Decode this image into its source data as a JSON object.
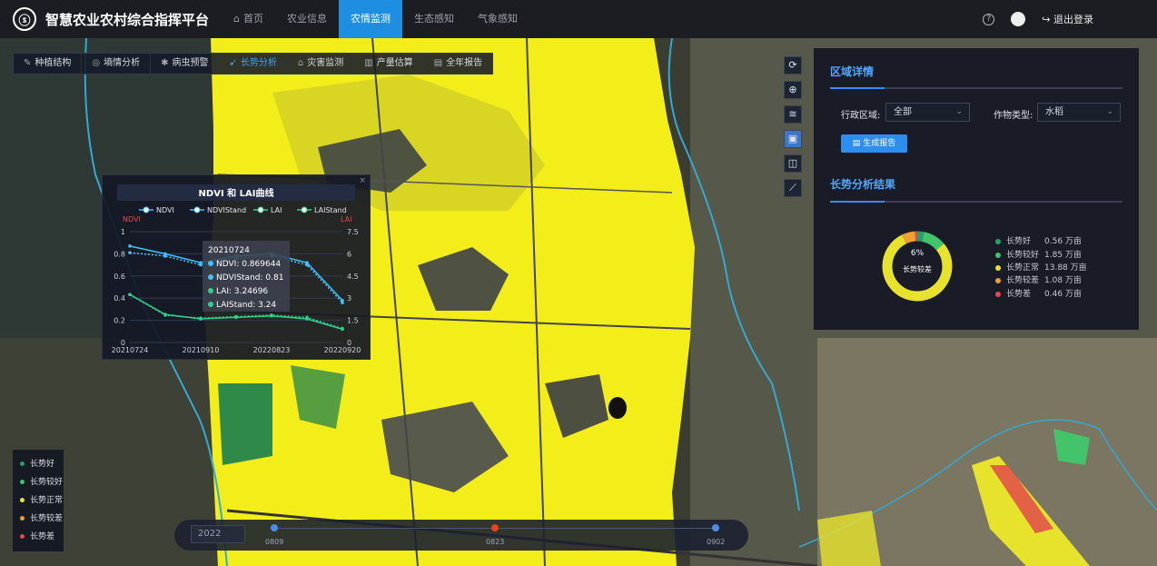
{
  "header": {
    "app_title": "智慧农业农村综合指挥平台",
    "nav": [
      {
        "label": "首页",
        "active": false
      },
      {
        "label": "农业信息",
        "active": false
      },
      {
        "label": "农情监测",
        "active": true
      },
      {
        "label": "生态感知",
        "active": false
      },
      {
        "label": "气象感知",
        "active": false
      }
    ],
    "help_glyph": "?",
    "logout_label": "退出登录"
  },
  "subtabs": [
    {
      "icon": "✎",
      "label": "种植结构",
      "active": false
    },
    {
      "icon": "◎",
      "label": "墒情分析",
      "active": false
    },
    {
      "icon": "✱",
      "label": "病虫预警",
      "active": false
    },
    {
      "icon": "➹",
      "label": "长势分析",
      "active": true
    },
    {
      "icon": "⌂",
      "label": "灾害监测",
      "active": false
    },
    {
      "icon": "▥",
      "label": "产量估算",
      "active": false
    },
    {
      "icon": "▤",
      "label": "全年报告",
      "active": false
    }
  ],
  "tools": [
    "refresh-icon",
    "locate-icon",
    "layers-icon",
    "image-icon",
    "book-icon",
    "ruler-icon"
  ],
  "region_panel": {
    "title": "区域详情",
    "region_label": "行政区域:",
    "region_value": "全部",
    "crop_label": "作物类型:",
    "crop_value": "水稻",
    "generate_label": "生成报告"
  },
  "growth_panel": {
    "title": "长势分析结果",
    "donut_percent": "6%",
    "donut_label": "长势较差",
    "items": [
      {
        "name": "长势好",
        "value": "0.56 万亩",
        "color": "#2a9d6e",
        "share": 0.031
      },
      {
        "name": "长势较好",
        "value": "1.85 万亩",
        "color": "#43c46b",
        "share": 0.107
      },
      {
        "name": "长势正常",
        "value": "13.88 万亩",
        "color": "#e7e32c",
        "share": 0.788
      },
      {
        "name": "长势较差",
        "value": "1.08 万亩",
        "color": "#f0a033",
        "share": 0.062
      },
      {
        "name": "长势差",
        "value": "0.46 万亩",
        "color": "#e04b4b",
        "share": 0.012
      }
    ]
  },
  "chart_popup": {
    "close_glyph": "×",
    "tooltip": {
      "date": "20210724",
      "lines": [
        "NDVI: 0.869644",
        "NDVIStand: 0.81",
        "LAI: 3.24696",
        "LAIStand: 3.24"
      ]
    }
  },
  "chart_data": {
    "type": "line",
    "title": "NDVI 和 LAI曲线",
    "legend": [
      "NDVI",
      "NDVIStand",
      "LAI",
      "LAIStand"
    ],
    "y_left_label": "NDVI",
    "y_right_label": "LAI",
    "y_left_ticks": [
      "0",
      "0.2",
      "0.4",
      "0.6",
      "0.8",
      "1"
    ],
    "y_right_ticks": [
      "0",
      "1.5",
      "3",
      "4.5",
      "6",
      "7.5"
    ],
    "ylim_left": [
      0,
      1
    ],
    "ylim_right": [
      0,
      7.5
    ],
    "x_ticks": [
      "20210724",
      "20210910",
      "20220823",
      "20220920"
    ],
    "x_count": 7,
    "series": [
      {
        "name": "NDVI",
        "axis": "left",
        "color": "#3fc2ff",
        "dashed": false,
        "x": [
          0,
          1,
          2,
          3,
          4,
          5,
          6
        ],
        "values": [
          0.87,
          0.8,
          0.72,
          0.78,
          0.8,
          0.72,
          0.38
        ]
      },
      {
        "name": "NDVIStand",
        "axis": "left",
        "color": "#3fc2ff",
        "dashed": true,
        "x": [
          0,
          1,
          2,
          3,
          4,
          5,
          6
        ],
        "values": [
          0.81,
          0.78,
          0.7,
          0.76,
          0.78,
          0.7,
          0.36
        ]
      },
      {
        "name": "LAI",
        "axis": "right",
        "color": "#2fd08a",
        "dashed": false,
        "x": [
          0,
          1,
          2,
          3,
          4,
          5,
          6
        ],
        "values": [
          3.25,
          1.9,
          1.6,
          1.7,
          1.8,
          1.6,
          0.9
        ]
      },
      {
        "name": "LAIStand",
        "axis": "right",
        "color": "#2fd08a",
        "dashed": true,
        "x": [
          0,
          1,
          2,
          3,
          4,
          5,
          6
        ],
        "values": [
          3.24,
          1.85,
          1.65,
          1.75,
          1.85,
          1.7,
          0.95
        ]
      }
    ],
    "grid": "horizontal",
    "legend_position": "top"
  },
  "map_legend": [
    {
      "name": "长势好",
      "color": "#2a9d6e"
    },
    {
      "name": "长势较好",
      "color": "#43c46b"
    },
    {
      "name": "长势正常",
      "color": "#e7e32c"
    },
    {
      "name": "长势较差",
      "color": "#f0a033"
    },
    {
      "name": "长势差",
      "color": "#e04b4b"
    }
  ],
  "timeline": {
    "year": "2022",
    "points": [
      {
        "label": "0809",
        "fraction": 0.0,
        "color": "#4a8ee8"
      },
      {
        "label": "0823",
        "fraction": 0.5,
        "color": "#e8431e"
      },
      {
        "label": "0902",
        "fraction": 1.0,
        "color": "#4a8ee8"
      }
    ]
  }
}
